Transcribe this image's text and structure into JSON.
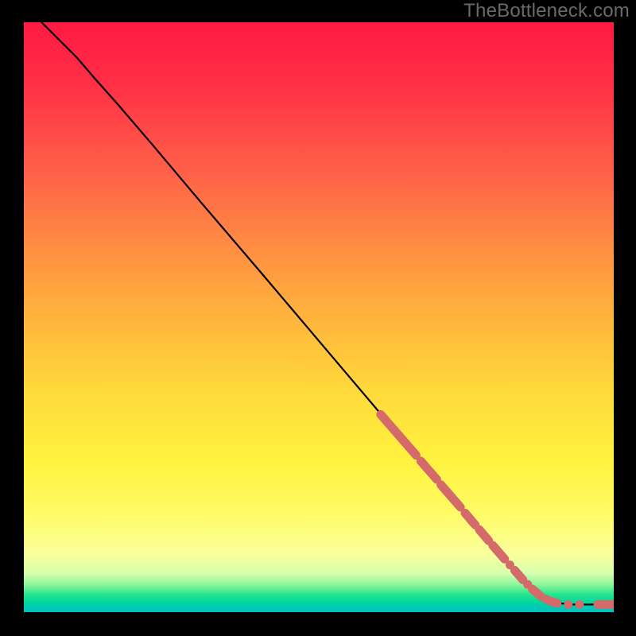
{
  "watermark": "TheBottleneck.com",
  "colors": {
    "gradient_stops": [
      "#ff1a42",
      "#ff5f48",
      "#ffb43c",
      "#fff23e",
      "#fbff9b",
      "#26e58d",
      "#00c2c5"
    ],
    "curve": "#000000",
    "marker": "#d46a6a",
    "background": "#000000"
  },
  "chart_data": {
    "type": "line",
    "title": "",
    "xlabel": "",
    "ylabel": "",
    "xlim": [
      0,
      100
    ],
    "ylim": [
      0,
      100
    ],
    "grid": false,
    "legend": false,
    "series": [
      {
        "name": "curve",
        "x": [
          3,
          6,
          9,
          12,
          16,
          22,
          30,
          40,
          50,
          60,
          70,
          78,
          84,
          88,
          91,
          93,
          95,
          100
        ],
        "y": [
          100,
          97,
          94,
          90.5,
          86,
          79,
          69.5,
          57.8,
          46,
          34.2,
          22.5,
          13,
          6.2,
          2.5,
          1.5,
          1.3,
          1.3,
          1.3
        ]
      }
    ],
    "markers": [
      {
        "kind": "segment",
        "x0": 60.5,
        "y0": 33.5,
        "x1": 66.5,
        "y1": 26.6
      },
      {
        "kind": "segment",
        "x0": 67.3,
        "y0": 25.6,
        "x1": 70.0,
        "y1": 22.5
      },
      {
        "kind": "segment",
        "x0": 70.7,
        "y0": 21.6,
        "x1": 74.0,
        "y1": 17.8
      },
      {
        "kind": "segment",
        "x0": 74.8,
        "y0": 16.8,
        "x1": 76.5,
        "y1": 14.8
      },
      {
        "kind": "segment",
        "x0": 77.2,
        "y0": 14.0,
        "x1": 78.8,
        "y1": 12.1
      },
      {
        "kind": "segment",
        "x0": 79.5,
        "y0": 11.3,
        "x1": 81.5,
        "y1": 9.0
      },
      {
        "kind": "dot",
        "x": 82.4,
        "y": 8.0
      },
      {
        "kind": "segment",
        "x0": 83.2,
        "y0": 7.1,
        "x1": 84.6,
        "y1": 5.5
      },
      {
        "kind": "dot",
        "x": 85.4,
        "y": 4.7
      },
      {
        "kind": "segment",
        "x0": 86.2,
        "y0": 3.9,
        "x1": 87.6,
        "y1": 2.7
      },
      {
        "kind": "dot",
        "x": 88.5,
        "y": 2.2
      },
      {
        "kind": "segment",
        "x0": 89.2,
        "y0": 1.9,
        "x1": 90.4,
        "y1": 1.5
      },
      {
        "kind": "dot",
        "x": 92.3,
        "y": 1.3
      },
      {
        "kind": "dot",
        "x": 94.2,
        "y": 1.3
      },
      {
        "kind": "segment",
        "x0": 97.3,
        "y0": 1.3,
        "x1": 100,
        "y1": 1.3
      }
    ]
  }
}
